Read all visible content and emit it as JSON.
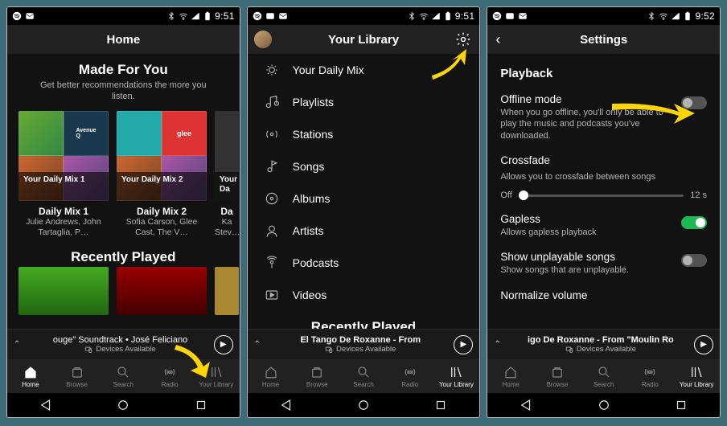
{
  "status": {
    "time": "9:51",
    "time3": "9:52"
  },
  "navTabs": [
    {
      "label": "Home"
    },
    {
      "label": "Browse"
    },
    {
      "label": "Search"
    },
    {
      "label": "Radio"
    },
    {
      "label": "Your Library"
    }
  ],
  "nowPlaying": {
    "devices": "Devices Available",
    "s1_track": "ouge\" Soundtrack • José Feliciano",
    "s2_track": "El Tango De Roxanne - From",
    "s3_track": "igo De Roxanne - From \"Moulin Ro"
  },
  "screen1": {
    "title": "Home",
    "section1_title": "Made For You",
    "section1_sub": "Get better recommendations the more you listen.",
    "cards": [
      {
        "strip": "Your Daily Mix 1",
        "title": "Daily Mix 1",
        "sub": "Julie Andrews, John Tartaglia, P…"
      },
      {
        "strip": "Your Daily Mix 2",
        "title": "Daily Mix 2",
        "sub": "Sofia Carson, Glee Cast, The V…"
      },
      {
        "strip": "Your Da",
        "title": "Da",
        "sub": "Ka Stev…"
      }
    ],
    "section2_title": "Recently Played"
  },
  "screen2": {
    "title": "Your Library",
    "items": [
      "Your Daily Mix",
      "Playlists",
      "Stations",
      "Songs",
      "Albums",
      "Artists",
      "Podcasts",
      "Videos"
    ],
    "section2_title": "Recently Played"
  },
  "screen3": {
    "title": "Settings",
    "section": "Playback",
    "rows": [
      {
        "title": "Offline mode",
        "desc": "When you go offline, you'll only be able to play the music and podcasts you've downloaded.",
        "toggle": "off"
      },
      {
        "title": "Crossfade",
        "desc": "Allows you to crossfade between songs",
        "slider": {
          "left": "Off",
          "right": "12 s"
        }
      },
      {
        "title": "Gapless",
        "desc": "Allows gapless playback",
        "toggle": "on"
      },
      {
        "title": "Show unplayable songs",
        "desc": "Show songs that are unplayable.",
        "toggle": "off"
      },
      {
        "title": "Normalize volume",
        "desc": ""
      }
    ]
  }
}
